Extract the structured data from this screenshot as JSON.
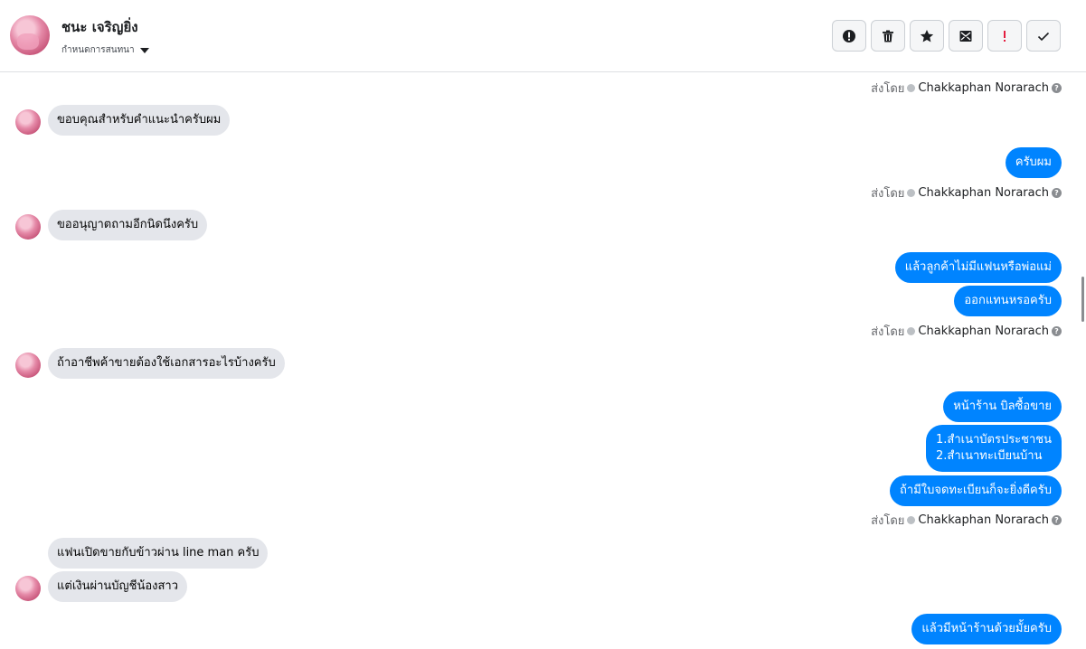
{
  "header": {
    "contact_name": "ชนะ เจริญยิ่ง",
    "assign_label": "กำหนดการสนทนา",
    "toolbar": [
      {
        "name": "report-icon",
        "tooltip": "!"
      },
      {
        "name": "trash-icon"
      },
      {
        "name": "star-icon"
      },
      {
        "name": "mark-unread-icon"
      },
      {
        "name": "spam-icon",
        "label": "!"
      },
      {
        "name": "checkmark-icon"
      }
    ]
  },
  "sent_by_prefix": "ส่งโดย",
  "agent_name": "Chakkaphan Norarach",
  "messages": [
    {
      "dir": "in",
      "text": "ขอบคุณสำหรับคำแนะนำครับผม"
    },
    {
      "dir": "out",
      "text": "ครับผม"
    },
    {
      "dir": "in",
      "text": "ขออนุญาตถามอีกนิดนึงครับ"
    },
    {
      "dir": "out",
      "text": "แล้วลูกค้าไม่มีแฟนหรือพ่อแม่"
    },
    {
      "dir": "out",
      "text": "ออกแทนหรอครับ"
    },
    {
      "dir": "in",
      "text": "ถ้าอาชีพค้าขายต้องใช้เอกสารอะไรบ้างครับ"
    },
    {
      "dir": "out",
      "text": "หน้าร้าน บิลซื้อขาย"
    },
    {
      "dir": "out",
      "line1": "1.สำเนาบัตรประชาชน",
      "line2": "2.สำเนาทะเบียนบ้าน"
    },
    {
      "dir": "out",
      "text": "ถ้ามีใบจดทะเบียนก็จะยิ่งดีครับ"
    },
    {
      "dir": "in",
      "text": "แฟนเปิดขายกับข้าวผ่าน line man ครับ"
    },
    {
      "dir": "in",
      "text": "แต่เงินผ่านบัญชีน้องสาว"
    },
    {
      "dir": "out",
      "text": "แล้วมีหน้าร้านด้วยมั้ยครับ"
    }
  ],
  "colors": {
    "outgoing": "#0084ff",
    "incoming": "#e4e6eb",
    "spam": "#e41e3f"
  }
}
